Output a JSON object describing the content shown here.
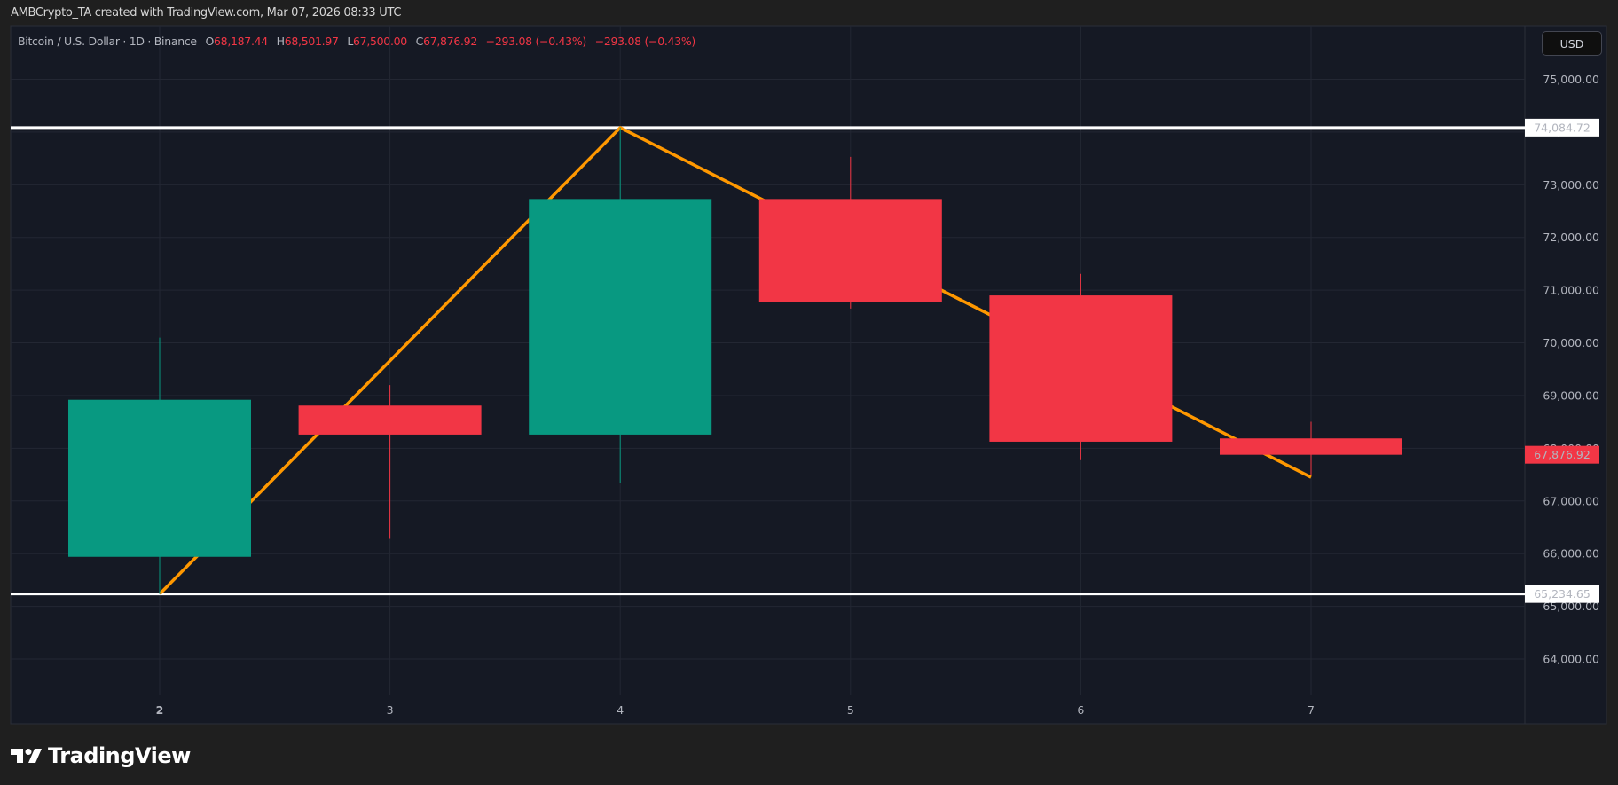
{
  "header": {
    "credit": "AMBCrypto_TA created with TradingView.com, Mar 07, 2026 08:33 UTC"
  },
  "legend": {
    "symbol": "Bitcoin / U.S. Dollar · 1D · Binance",
    "o_label": "O",
    "o": "68,187.44",
    "h_label": "H",
    "h": "68,501.97",
    "l_label": "L",
    "l": "67,500.00",
    "c_label": "C",
    "c": "67,876.92",
    "change1": "−293.08 (−0.43%)",
    "change2": "−293.08 (−0.43%)"
  },
  "currency_button": "USD",
  "logo": "TradingView",
  "colors": {
    "up": "#089981",
    "down": "#f23645",
    "line": "#ff9800",
    "level": "#ffffff",
    "bg": "#151924"
  },
  "chart_data": {
    "type": "candlestick",
    "title": "Bitcoin / U.S. Dollar · 1D · Binance",
    "x_ticks": [
      "2",
      "3",
      "4",
      "5",
      "6",
      "7"
    ],
    "y_ticks": [
      "64,000.00",
      "65,000.00",
      "66,000.00",
      "67,000.00",
      "68,000.00",
      "69,000.00",
      "70,000.00",
      "71,000.00",
      "72,000.00",
      "73,000.00",
      "74,000.00",
      "75,000.00"
    ],
    "y_tick_values": [
      64000,
      65000,
      66000,
      67000,
      68000,
      69000,
      70000,
      71000,
      72000,
      73000,
      74000,
      75000
    ],
    "ylim": [
      63200,
      76000
    ],
    "candles": [
      {
        "day": "2",
        "open": 65940,
        "high": 70100,
        "low": 65234,
        "close": 68920
      },
      {
        "day": "3",
        "open": 68810,
        "high": 69200,
        "low": 66280,
        "close": 68260
      },
      {
        "day": "4",
        "open": 68260,
        "high": 74084,
        "low": 67345,
        "close": 72730
      },
      {
        "day": "5",
        "open": 72730,
        "high": 73530,
        "low": 70650,
        "close": 70770
      },
      {
        "day": "6",
        "open": 70900,
        "high": 71310,
        "low": 67775,
        "close": 68125
      },
      {
        "day": "7",
        "open": 68187.44,
        "high": 68501.97,
        "low": 67500,
        "close": 67876.92
      }
    ],
    "levels": [
      {
        "label": "74,084.72",
        "value": 74084.72
      },
      {
        "label": "65,234.65",
        "value": 65234.65
      }
    ],
    "last_price": {
      "label": "67,876.92",
      "value": 67876.92
    },
    "trend_line": [
      {
        "day": "2",
        "price": 65234
      },
      {
        "day": "4",
        "price": 74084
      },
      {
        "day": "7",
        "price": 67450
      }
    ]
  }
}
